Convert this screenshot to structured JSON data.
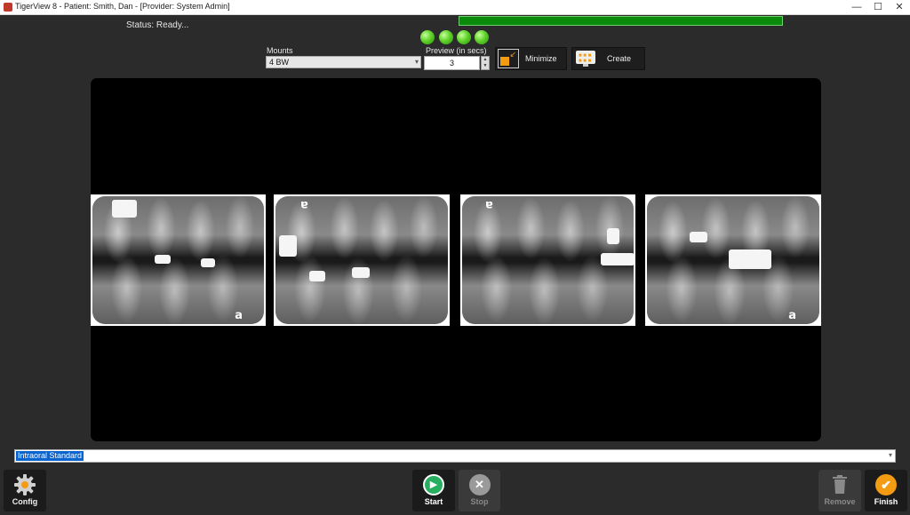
{
  "window": {
    "title": "TigerView 8 - Patient: Smith, Dan - [Provider: System Admin]",
    "controls": {
      "minimize": "—",
      "maximize": "☐",
      "close": "✕"
    }
  },
  "status": {
    "text": "Status: Ready...",
    "progress_percent": 100
  },
  "indicators": {
    "count": 4,
    "color": "#5fd32b"
  },
  "mounts": {
    "label": "Mounts",
    "selected": "4 BW"
  },
  "preview": {
    "label": "Preview (in secs)",
    "value": "3"
  },
  "toolbar": {
    "minimize_label": "Minimize",
    "create_label": "Create"
  },
  "images": [
    {
      "marker": "a",
      "marker_position": "bottom-right"
    },
    {
      "marker": "a",
      "marker_position": "top-left-upside-down"
    },
    {
      "marker": "a",
      "marker_position": "top-left-upside-down"
    },
    {
      "marker": "a",
      "marker_position": "bottom-right"
    }
  ],
  "protocol": {
    "selected": "Intraoral Standard"
  },
  "buttons": {
    "config": "Config",
    "start": "Start",
    "stop": "Stop",
    "remove": "Remove",
    "finish": "Finish"
  },
  "colors": {
    "accent_orange": "#f39c12",
    "start_green": "#27ae60",
    "progress_green": "#0a8a0a",
    "selection_blue": "#0a64d0"
  }
}
